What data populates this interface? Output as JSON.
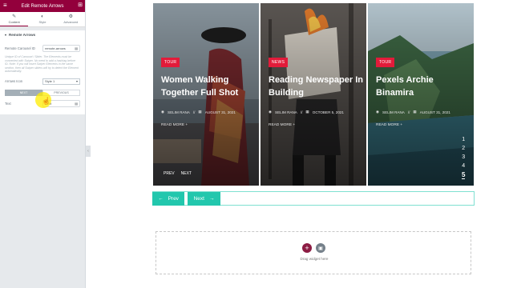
{
  "panel": {
    "title": "Edit Remote Arrows",
    "tabs": [
      {
        "label": "Content",
        "icon": "pencil-icon",
        "glyph": "✎"
      },
      {
        "label": "Style",
        "icon": "half-circle-icon",
        "glyph": "◐"
      },
      {
        "label": "Advanced",
        "icon": "gear-icon",
        "glyph": "⚙"
      }
    ],
    "section_title": "Remote Arrows",
    "carousel_id_label": "Remote Carousel ID",
    "carousel_id_value": "remote-arrows",
    "help_text": "Unique ID of Carousel / Slider. The Elements must be connected with Swiper. No need to add a hashtag before ID. Note: If you will insert Swiper Elements in the same section, then all Swiper sliders will try to detect the Element automatically.",
    "arrows_icon_label": "Arrows Icon",
    "arrows_icon_value": "Style 1",
    "button_next": "NEXT",
    "button_previous": "PREVIOUS",
    "text_label": "Text",
    "text_value": "Next"
  },
  "slides": [
    {
      "badge": "TOUR",
      "title": "Women Walking Together Full Shot",
      "author": "SELIM RANA",
      "date": "AUGUST 31, 2021",
      "read_more": "READ MORE",
      "image": "woman-with-hat-photo"
    },
    {
      "badge": "NEWS",
      "title": "Reading Newspaper In Building",
      "author": "SELIM RANA",
      "date": "OCTOBER 5, 2021",
      "read_more": "READ MORE",
      "image": "burning-newspaper-photo"
    },
    {
      "badge": "TOUR",
      "title": "Pexels Archie Binamira",
      "author": "SELIM RANA",
      "date": "AUGUST 31, 2021",
      "read_more": "READ MORE",
      "image": "coastal-cliff-photo"
    }
  ],
  "slider_nav": {
    "prev": "PREV",
    "next": "NEXT"
  },
  "pagination": [
    "1",
    "2",
    "3",
    "4",
    "5"
  ],
  "pagination_active": "5",
  "arrows": {
    "prev_label": "Prev",
    "next_label": "Next"
  },
  "dropzone": {
    "text": "Drag widget here"
  },
  "colors": {
    "brand": "#93003c",
    "accent": "#22c7ad",
    "badge": "#e21b3a"
  }
}
